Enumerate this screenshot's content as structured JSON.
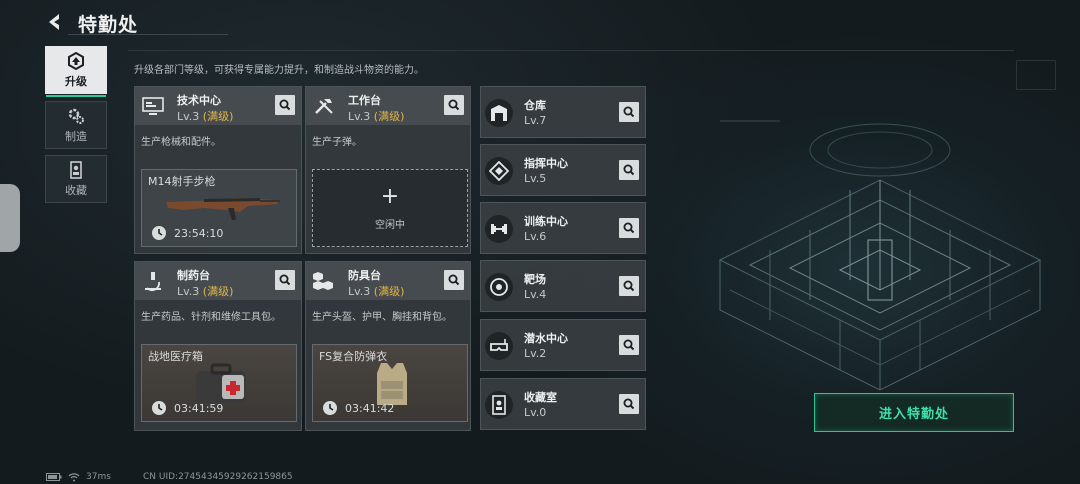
{
  "header": {
    "title": "特勤处"
  },
  "nav": [
    {
      "label": "升级",
      "icon": "upgrade-icon",
      "active": true
    },
    {
      "label": "制造",
      "icon": "craft-gear-icon",
      "active": false
    },
    {
      "label": "收藏",
      "icon": "collection-icon",
      "active": false
    }
  ],
  "description": "升级各部门等级，可获得专属能力提升，和制造战斗物资的能力。",
  "cards": [
    {
      "name": "技术中心",
      "level": "Lv.3",
      "max": "(满级)",
      "desc": "生产枪械和配件。",
      "product": "M14射手步枪",
      "timer": "23:54:10"
    },
    {
      "name": "工作台",
      "level": "Lv.3",
      "max": "(满级)",
      "desc": "生产子弹。",
      "idle_label": "空闲中"
    },
    {
      "name": "制药台",
      "level": "Lv.3",
      "max": "(满级)",
      "desc": "生产药品、针剂和维修工具包。",
      "product": "战地医疗箱",
      "timer": "03:41:59"
    },
    {
      "name": "防具台",
      "level": "Lv.3",
      "max": "(满级)",
      "desc": "生产头盔、护甲、胸挂和背包。",
      "product": "FS复合防弹衣",
      "timer": "03:41:42"
    }
  ],
  "rooms": [
    {
      "name": "仓库",
      "level": "Lv.7",
      "icon": "warehouse-icon"
    },
    {
      "name": "指挥中心",
      "level": "Lv.5",
      "icon": "command-center-icon"
    },
    {
      "name": "训练中心",
      "level": "Lv.6",
      "icon": "dumbbell-icon"
    },
    {
      "name": "靶场",
      "level": "Lv.4",
      "icon": "target-icon"
    },
    {
      "name": "潜水中心",
      "level": "Lv.2",
      "icon": "diving-mask-icon"
    },
    {
      "name": "收藏室",
      "level": "Lv.0",
      "icon": "collection-room-icon"
    }
  ],
  "enter_button": "进入特勤处",
  "status": {
    "ping": "37ms",
    "uid": "CN UID:27454345929262159865"
  },
  "colors": {
    "accent": "#2ec99a",
    "max_level": "#e0b64a"
  }
}
